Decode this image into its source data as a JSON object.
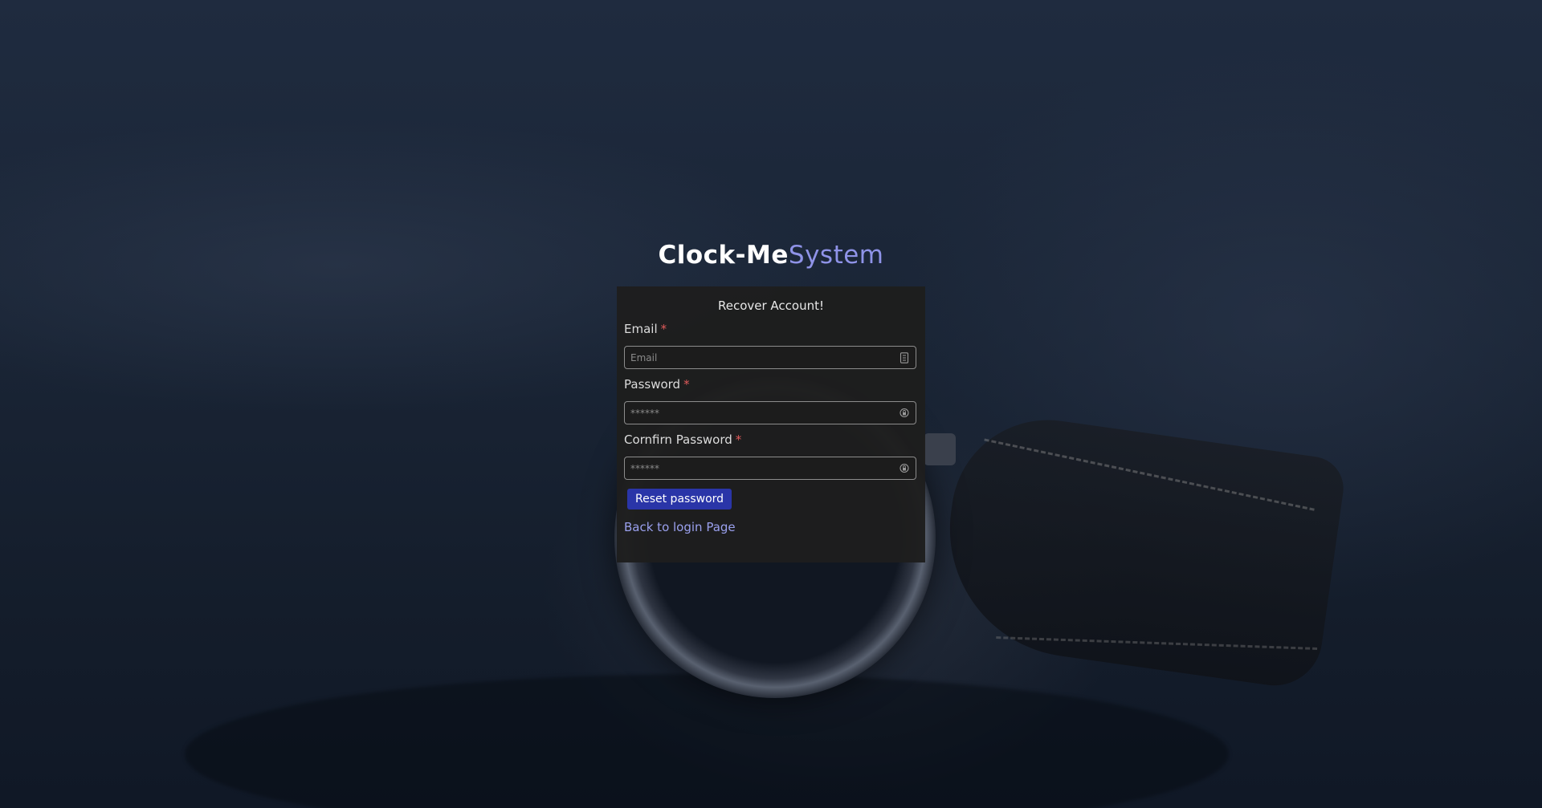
{
  "brand": {
    "name_bold": "Clock-Me",
    "name_light": "System"
  },
  "form": {
    "heading": "Recover Account!",
    "required_mark": "*",
    "email": {
      "label": "Email",
      "placeholder": "Email",
      "value": "",
      "icon": "id-card-icon"
    },
    "password": {
      "label": "Password",
      "placeholder": "******",
      "value": "",
      "icon": "lock-icon"
    },
    "confirm_password": {
      "label": "Cornfirn Password",
      "placeholder": "******",
      "value": "",
      "icon": "lock-icon"
    },
    "submit_label": "Reset password",
    "back_link": "Back to login Page"
  },
  "colors": {
    "accent": "#2a35a8",
    "brand_light": "#8f93e8",
    "link": "#9aa0ee",
    "required": "#e05a5a",
    "card_bg": "#1e1e1e"
  }
}
